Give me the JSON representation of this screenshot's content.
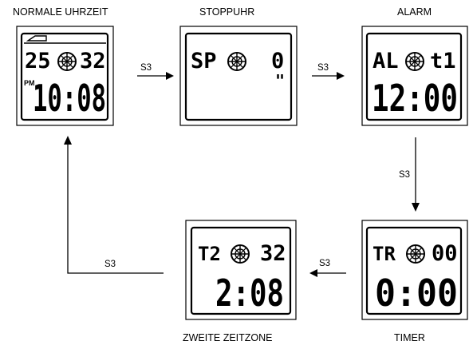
{
  "modes": {
    "normal": {
      "label": "NORMALE UHRZEIT",
      "top_left": "25",
      "top_right": "32",
      "indicator": "PM",
      "main": "10:08",
      "symbol": "dial-icon"
    },
    "stopwatch": {
      "label": "STOPPUHR",
      "top_left": "SP",
      "top_right": "0",
      "unit": "\"",
      "symbol": "dial-icon"
    },
    "alarm": {
      "label": "ALARM",
      "top_left": "AL",
      "top_right": "t1",
      "main": "12:00",
      "symbol": "dial-icon"
    },
    "timer": {
      "label": "TIMER",
      "top_left": "TR",
      "top_right": "00",
      "main": "0:00",
      "symbol": "dial-icon"
    },
    "second_zone": {
      "label": "ZWEITE ZEITZONE",
      "top_left": "T2",
      "top_right": "32",
      "main": "2:08",
      "symbol": "dial-icon"
    }
  },
  "transitions": [
    {
      "from": "normal",
      "to": "stopwatch",
      "button": "S3"
    },
    {
      "from": "stopwatch",
      "to": "alarm",
      "button": "S3"
    },
    {
      "from": "alarm",
      "to": "timer",
      "button": "S3"
    },
    {
      "from": "timer",
      "to": "second_zone",
      "button": "S3"
    },
    {
      "from": "second_zone",
      "to": "normal",
      "button": "S3"
    }
  ]
}
